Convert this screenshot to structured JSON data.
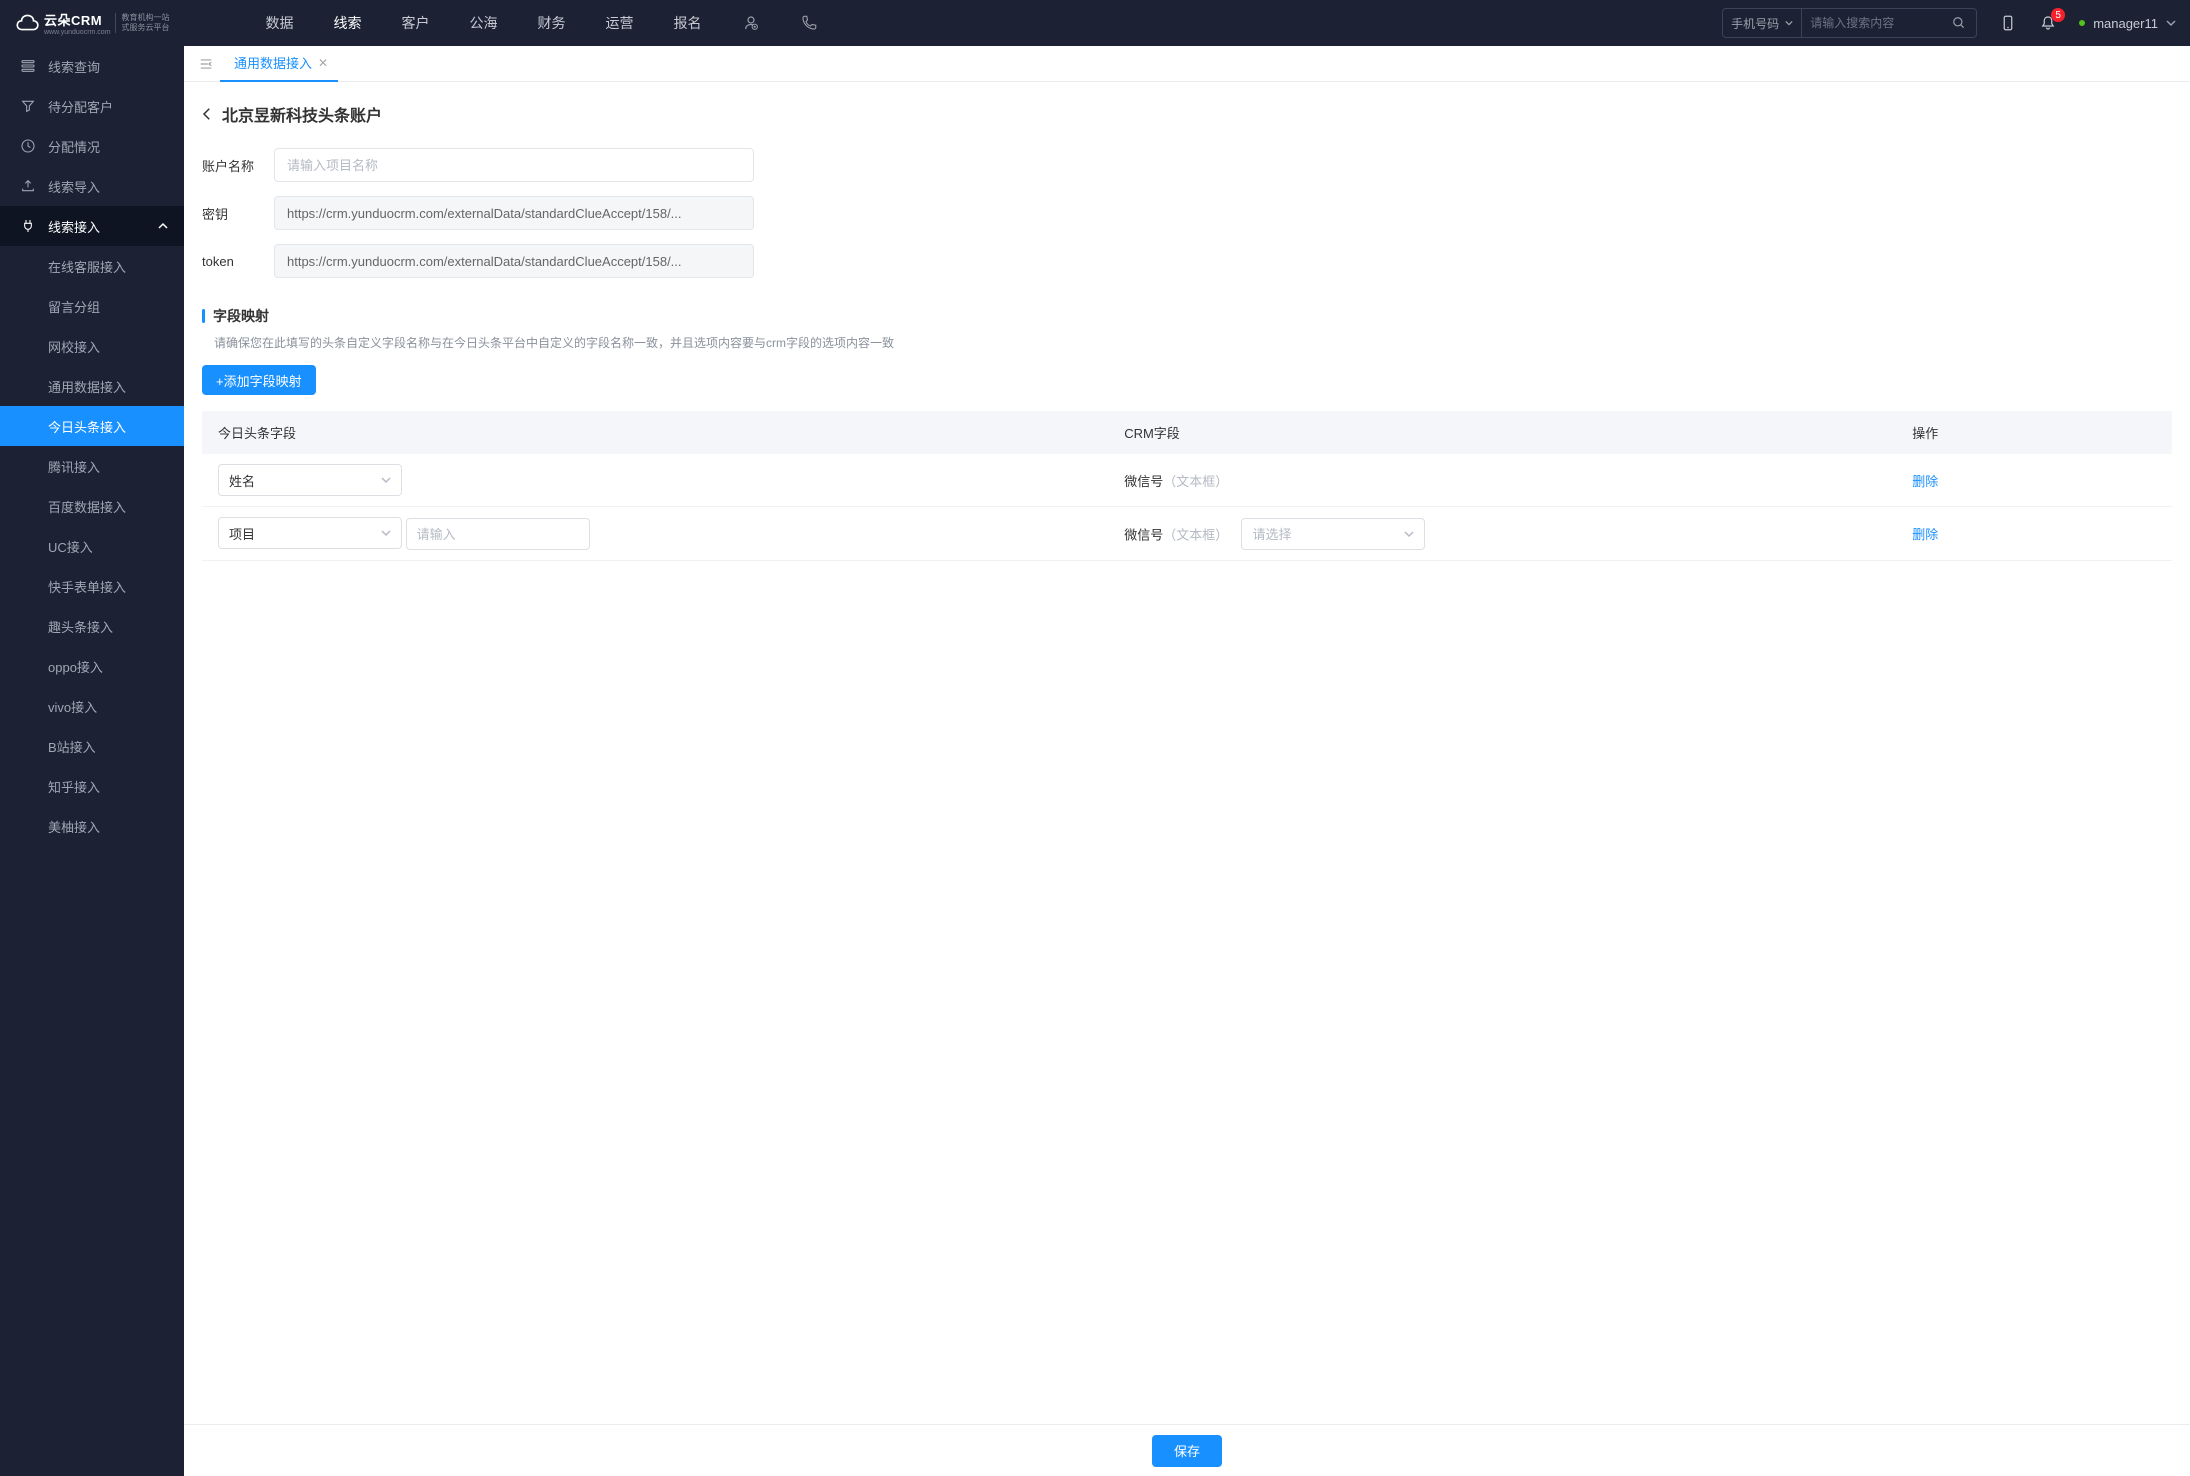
{
  "header": {
    "brand": "云朵CRM",
    "brand_sub1": "教育机构一站",
    "brand_sub2": "式服务云平台",
    "brand_domain": "www.yunduocrm.com",
    "nav": [
      "数据",
      "线索",
      "客户",
      "公海",
      "财务",
      "运营",
      "报名"
    ],
    "active_nav_index": 1,
    "search_type": "手机号码",
    "search_placeholder": "请输入搜索内容",
    "notif_count": "5",
    "user": "manager11"
  },
  "sidebar": {
    "items": [
      {
        "label": "线索查询",
        "icon": "list"
      },
      {
        "label": "待分配客户",
        "icon": "filter"
      },
      {
        "label": "分配情况",
        "icon": "clock"
      },
      {
        "label": "线索导入",
        "icon": "upload"
      },
      {
        "label": "线索接入",
        "icon": "plug",
        "expanded": true,
        "children": [
          {
            "label": "在线客服接入"
          },
          {
            "label": "留言分组"
          },
          {
            "label": "网校接入"
          },
          {
            "label": "通用数据接入"
          },
          {
            "label": "今日头条接入",
            "active": true
          },
          {
            "label": "腾讯接入"
          },
          {
            "label": "百度数据接入"
          },
          {
            "label": "UC接入"
          },
          {
            "label": "快手表单接入"
          },
          {
            "label": "趣头条接入"
          },
          {
            "label": "oppo接入"
          },
          {
            "label": "vivo接入"
          },
          {
            "label": "B站接入"
          },
          {
            "label": "知乎接入"
          },
          {
            "label": "美柚接入"
          }
        ]
      }
    ]
  },
  "tabs": {
    "items": [
      {
        "label": "通用数据接入"
      }
    ]
  },
  "page": {
    "title": "北京昱新科技头条账户",
    "form": {
      "account_name_label": "账户名称",
      "account_name_placeholder": "请输入项目名称",
      "secret_label": "密钥",
      "secret_value": "https://crm.yunduocrm.com/externalData/standardClueAccept/158/...",
      "token_label": "token",
      "token_value": "https://crm.yunduocrm.com/externalData/standardClueAccept/158/..."
    },
    "mapping": {
      "title": "字段映射",
      "desc": "请确保您在此填写的头条自定义字段名称与在今日头条平台中自定义的字段名称一致，并且选项内容要与crm字段的选项内容一致",
      "add_label": "+添加字段映射",
      "cols": {
        "tt_field": "今日头条字段",
        "crm_field": "CRM字段",
        "actions": "操作"
      },
      "rows": [
        {
          "tt_field": "姓名",
          "tt_extra": false,
          "crm_field": "微信号",
          "crm_hint": "（文本框）",
          "crm_select": false,
          "del_label": "删除"
        },
        {
          "tt_field": "项目",
          "tt_extra": true,
          "tt_extra_placeholder": "请输入",
          "crm_field": "微信号",
          "crm_hint": "（文本框）",
          "crm_select": true,
          "crm_select_placeholder": "请选择",
          "del_label": "删除"
        }
      ]
    },
    "save_label": "保存"
  }
}
